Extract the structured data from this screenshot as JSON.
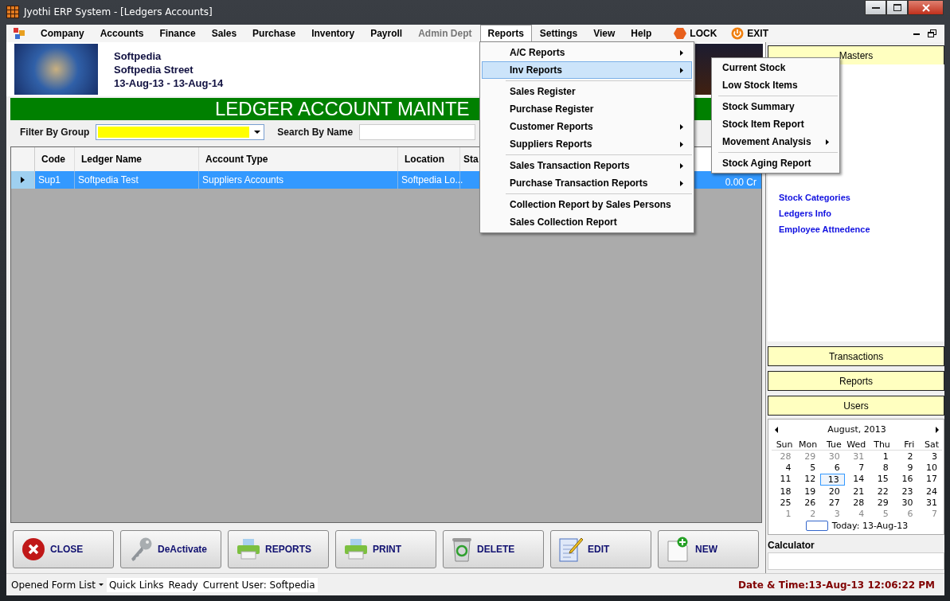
{
  "window": {
    "title": "Jyothi ERP System - [Ledgers Accounts]"
  },
  "menu": {
    "items": [
      {
        "label": "Company",
        "selected": false,
        "disabled": false
      },
      {
        "label": "Accounts",
        "selected": false,
        "disabled": false
      },
      {
        "label": "Finance",
        "selected": false,
        "disabled": false
      },
      {
        "label": "Sales",
        "selected": false,
        "disabled": false
      },
      {
        "label": "Purchase",
        "selected": false,
        "disabled": false
      },
      {
        "label": "Inventory",
        "selected": false,
        "disabled": false
      },
      {
        "label": "Payroll",
        "selected": false,
        "disabled": false
      },
      {
        "label": "Admin Dept",
        "selected": false,
        "disabled": true
      },
      {
        "label": "Reports",
        "selected": true,
        "disabled": false
      },
      {
        "label": "Settings",
        "selected": false,
        "disabled": false
      },
      {
        "label": "View",
        "selected": false,
        "disabled": false
      },
      {
        "label": "Help",
        "selected": false,
        "disabled": false
      }
    ],
    "actions": [
      {
        "label": "LOCK",
        "kind": "lock"
      },
      {
        "label": "EXIT",
        "kind": "exit"
      }
    ]
  },
  "company": {
    "name": "Softpedia",
    "street": "Softpedia Street",
    "period": "13-Aug-13 - 13-Aug-14"
  },
  "banner": "LEDGER ACCOUNT MAINTE",
  "filter": {
    "label": "Filter By Group"
  },
  "search": {
    "label": "Search By Name"
  },
  "table": {
    "columns": [
      "Code",
      "Ledger Name",
      "Account Type",
      "Location",
      "Sta"
    ],
    "rows": [
      {
        "cells": [
          "Sup1",
          "Softpedia Test",
          "Suppliers Accounts",
          "Softpedia Lo..."
        ],
        "column_6": "0.00 Cr",
        "selected": true
      }
    ]
  },
  "dropdown": {
    "groups": [
      [
        {
          "label": "A/C Reports",
          "submenu": true,
          "selected": false
        },
        {
          "label": "Inv Reports",
          "submenu": true,
          "selected": true
        }
      ],
      [
        {
          "label": "Sales Register",
          "submenu": false,
          "selected": false
        },
        {
          "label": "Purchase Register",
          "submenu": false,
          "selected": false
        },
        {
          "label": "Customer Reports",
          "submenu": true,
          "selected": false
        },
        {
          "label": "Suppliers Reports",
          "submenu": true,
          "selected": false
        }
      ],
      [
        {
          "label": "Sales Transaction Reports",
          "submenu": true,
          "selected": false
        },
        {
          "label": "Purchase Transaction Reports",
          "submenu": true,
          "selected": false
        }
      ],
      [
        {
          "label": "Collection Report by Sales Persons",
          "submenu": false,
          "selected": false
        },
        {
          "label": "Sales Collection Report",
          "submenu": false,
          "selected": false
        }
      ]
    ]
  },
  "submenu": {
    "groups": [
      [
        {
          "label": "Current Stock",
          "submenu": false
        },
        {
          "label": "Low Stock Items",
          "submenu": false
        }
      ],
      [
        {
          "label": "Stock Summary",
          "submenu": false
        },
        {
          "label": "Stock Item Report",
          "submenu": false
        },
        {
          "label": "Movement Analysis",
          "submenu": true
        }
      ],
      [
        {
          "label": "Stock Aging Report",
          "submenu": false
        }
      ]
    ]
  },
  "sidebar": {
    "panels": [
      {
        "title": "Masters",
        "expanded": true,
        "links": [
          "Stock Categories",
          "Ledgers Info",
          "Employee Attnedence"
        ]
      },
      {
        "title": "Transactions",
        "expanded": false
      },
      {
        "title": "Reports",
        "expanded": false
      },
      {
        "title": "Users",
        "expanded": false
      }
    ]
  },
  "calendar": {
    "month": "August, 2013",
    "weekdays": [
      "Sun",
      "Mon",
      "Tue",
      "Wed",
      "Thu",
      "Fri",
      "Sat"
    ],
    "days": [
      {
        "day": "28",
        "other_month": true,
        "selected": false
      },
      {
        "day": "29",
        "other_month": true,
        "selected": false
      },
      {
        "day": "30",
        "other_month": true,
        "selected": false
      },
      {
        "day": "31",
        "other_month": true,
        "selected": false
      },
      {
        "day": "1",
        "other_month": false,
        "selected": false
      },
      {
        "day": "2",
        "other_month": false,
        "selected": false
      },
      {
        "day": "3",
        "other_month": false,
        "selected": false
      },
      {
        "day": "4",
        "other_month": false,
        "selected": false
      },
      {
        "day": "5",
        "other_month": false,
        "selected": false
      },
      {
        "day": "6",
        "other_month": false,
        "selected": false
      },
      {
        "day": "7",
        "other_month": false,
        "selected": false
      },
      {
        "day": "8",
        "other_month": false,
        "selected": false
      },
      {
        "day": "9",
        "other_month": false,
        "selected": false
      },
      {
        "day": "10",
        "other_month": false,
        "selected": false
      },
      {
        "day": "11",
        "other_month": false,
        "selected": false
      },
      {
        "day": "12",
        "other_month": false,
        "selected": false
      },
      {
        "day": "13",
        "other_month": false,
        "selected": true
      },
      {
        "day": "14",
        "other_month": false,
        "selected": false
      },
      {
        "day": "15",
        "other_month": false,
        "selected": false
      },
      {
        "day": "16",
        "other_month": false,
        "selected": false
      },
      {
        "day": "17",
        "other_month": false,
        "selected": false
      },
      {
        "day": "18",
        "other_month": false,
        "selected": false
      },
      {
        "day": "19",
        "other_month": false,
        "selected": false
      },
      {
        "day": "20",
        "other_month": false,
        "selected": false
      },
      {
        "day": "21",
        "other_month": false,
        "selected": false
      },
      {
        "day": "22",
        "other_month": false,
        "selected": false
      },
      {
        "day": "23",
        "other_month": false,
        "selected": false
      },
      {
        "day": "24",
        "other_month": false,
        "selected": false
      },
      {
        "day": "25",
        "other_month": false,
        "selected": false
      },
      {
        "day": "26",
        "other_month": false,
        "selected": false
      },
      {
        "day": "27",
        "other_month": false,
        "selected": false
      },
      {
        "day": "28",
        "other_month": false,
        "selected": false
      },
      {
        "day": "29",
        "other_month": false,
        "selected": false
      },
      {
        "day": "30",
        "other_month": false,
        "selected": false
      },
      {
        "day": "31",
        "other_month": false,
        "selected": false
      },
      {
        "day": "1",
        "other_month": true,
        "selected": false
      },
      {
        "day": "2",
        "other_month": true,
        "selected": false
      },
      {
        "day": "3",
        "other_month": true,
        "selected": false
      },
      {
        "day": "4",
        "other_month": true,
        "selected": false
      },
      {
        "day": "5",
        "other_month": true,
        "selected": false
      },
      {
        "day": "6",
        "other_month": true,
        "selected": false
      },
      {
        "day": "7",
        "other_month": true,
        "selected": false
      }
    ],
    "today": "Today: 13-Aug-13"
  },
  "calculator": {
    "label": "Calculator"
  },
  "buttons": [
    {
      "label": "CLOSE",
      "kind": "close"
    },
    {
      "label": "DeActivate",
      "kind": "key"
    },
    {
      "label": "REPORTS",
      "kind": "printer"
    },
    {
      "label": "PRINT",
      "kind": "printer"
    },
    {
      "label": "DELETE",
      "kind": "recycle"
    },
    {
      "label": "EDIT",
      "kind": "notepad"
    },
    {
      "label": "NEW",
      "kind": "new"
    }
  ],
  "status_bar": {
    "items": [
      {
        "label": "Opened Form List",
        "kind": "dropdown"
      },
      {
        "label": "Quick Links",
        "kind": "text"
      },
      {
        "label": "Ready",
        "kind": "text"
      },
      {
        "label": "Current User: Softpedia",
        "kind": "text"
      }
    ],
    "datetime": "Date & Time:13-Aug-13 12:06:22 PM"
  }
}
